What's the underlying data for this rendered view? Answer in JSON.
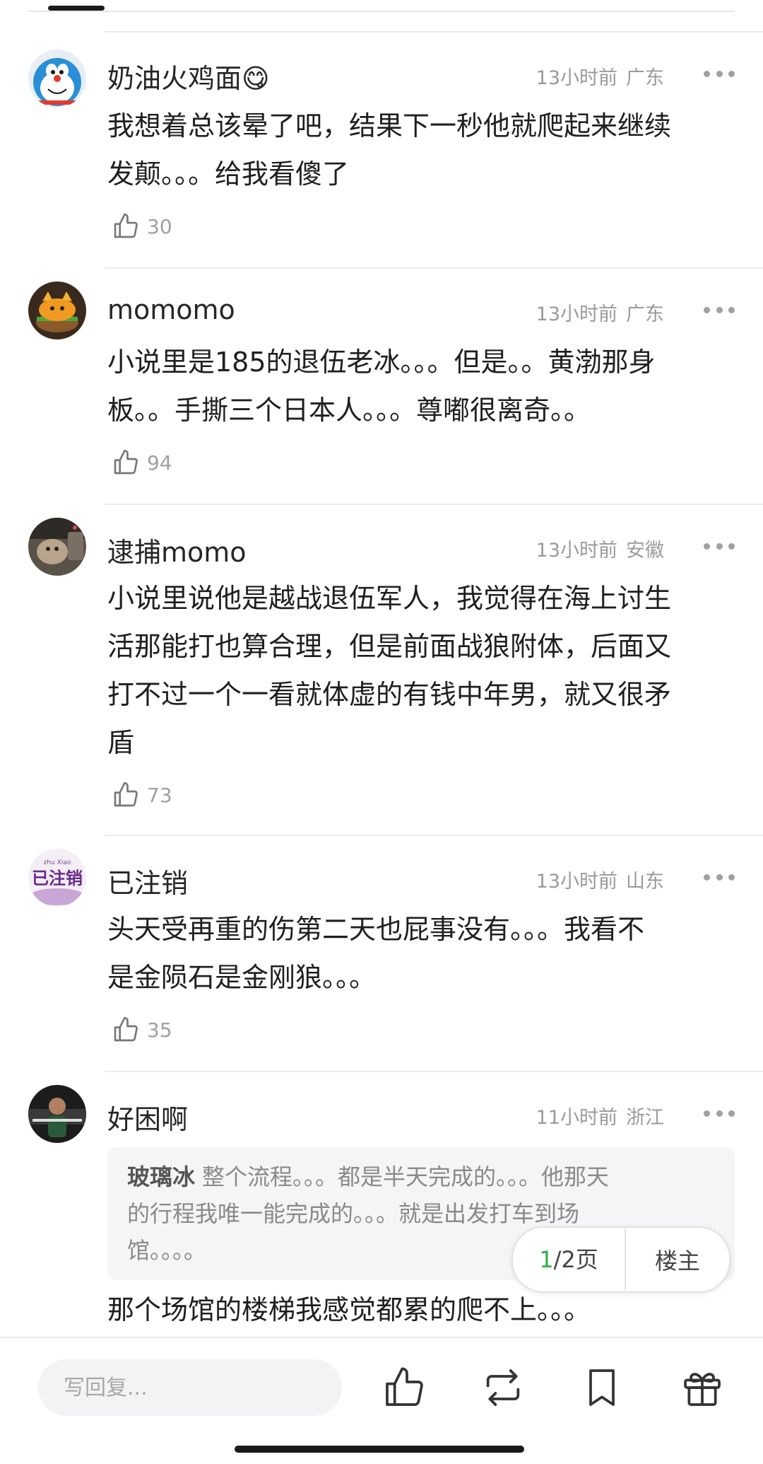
{
  "comments": [
    {
      "username": "奶油火鸡面",
      "emoji": "😋",
      "time": "13小时前",
      "location": "广东",
      "lines": [
        "我想着总该晕了吧，结果下一秒他就爬起来继续",
        "发颠。。。给我看傻了"
      ],
      "likes": "30"
    },
    {
      "username": "momomo",
      "time": "13小时前",
      "location": "广东",
      "lines": [
        "小说里是185的退伍老冰。。。但是。。黄渤那身",
        "板。。手撕三个日本人。。。尊嘟很离奇。。"
      ],
      "likes": "94"
    },
    {
      "username": "逮捕momo",
      "time": "13小时前",
      "location": "安徽",
      "lines": [
        "小说里说他是越战退伍军人，我觉得在海上讨生",
        "活那能打也算合理，但是前面战狼附体，后面又",
        "打不过一个一看就体虚的有钱中年男，就又很矛",
        "盾"
      ],
      "likes": "73"
    },
    {
      "username": "已注销",
      "time": "13小时前",
      "location": "山东",
      "lines": [
        "头天受再重的伤第二天也屁事没有。。。我看不",
        "是金陨石是金刚狼。。。"
      ],
      "likes": "35"
    },
    {
      "username": "好困啊",
      "time": "11小时前",
      "location": "浙江",
      "quote": {
        "name": "玻璃冰",
        "lines": [
          "整个流程。。。都是半天完成的。。。他那天",
          "的行程我唯一能完成的。。。就是出发打车到场",
          "馆。。。。"
        ]
      },
      "lines": [
        "那个场馆的楼梯我感觉都累的爬不上。。。"
      ]
    }
  ],
  "avatar_text": {
    "deregistered_small": "zhu Xiao",
    "deregistered_main": "已注销"
  },
  "pager": {
    "current": "1",
    "total": "/2页",
    "owner_label": "楼主"
  },
  "bottom_bar": {
    "reply_placeholder": "写回复...",
    "icons": [
      "thumb-up-icon",
      "repost-icon",
      "bookmark-icon",
      "gift-icon"
    ]
  },
  "colors": {
    "accent_green": "#2ab048",
    "meta_gray": "#9a9a9a"
  }
}
